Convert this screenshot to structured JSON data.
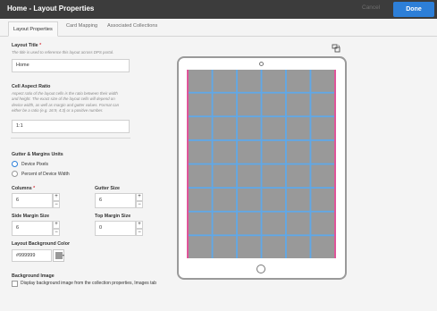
{
  "header": {
    "title": "Home - Layout Properties",
    "cancel_label": "Cancel",
    "done_label": "Done"
  },
  "tabs": [
    {
      "label": "Layout Properties",
      "active": true
    },
    {
      "label": "Card Mapping",
      "active": false
    },
    {
      "label": "Associated Collections",
      "active": false
    }
  ],
  "form": {
    "layout_title": {
      "label": "Layout Title",
      "required_mark": "*",
      "help": "The title is used to reference this layout across DPS portal.",
      "value": "Home"
    },
    "cell_aspect_ratio": {
      "label": "Cell Aspect Ratio",
      "help_lines": [
        "Aspect ratio of the layout cells is the ratio between their width",
        "and height. The exact size of the layout cells will depend on",
        "device width, as well as margin and gutter values. Format can",
        "either be a ratio (e.g. 16:9, 4:3) or a positive number."
      ],
      "value": "1:1"
    },
    "gutter_units": {
      "label": "Gutter & Margins Units",
      "options": [
        {
          "label": "Device Pixels",
          "selected": true
        },
        {
          "label": "Percent of Device Width",
          "selected": false
        }
      ]
    },
    "columns": {
      "label": "Columns",
      "required_mark": "*",
      "value": "6"
    },
    "gutter_size": {
      "label": "Gutter Size",
      "value": "6"
    },
    "side_margin": {
      "label": "Side Margin Size",
      "value": "6"
    },
    "top_margin": {
      "label": "Top Margin Size",
      "value": "0"
    },
    "stepper": {
      "plus": "+",
      "minus": "−"
    },
    "background_color": {
      "label": "Layout Background Color",
      "value": "#999999"
    },
    "background_image": {
      "label": "Background Image",
      "checkbox_label": "Display background image from the collection properties, Images tab",
      "checked": false
    }
  },
  "preview": {
    "columns": 6,
    "rows": 8,
    "cell_color": "#999999",
    "gutter_color": "#5fa8e8",
    "margin_color": "#e0559a",
    "rotate_icon": "rotate-device-icon"
  }
}
